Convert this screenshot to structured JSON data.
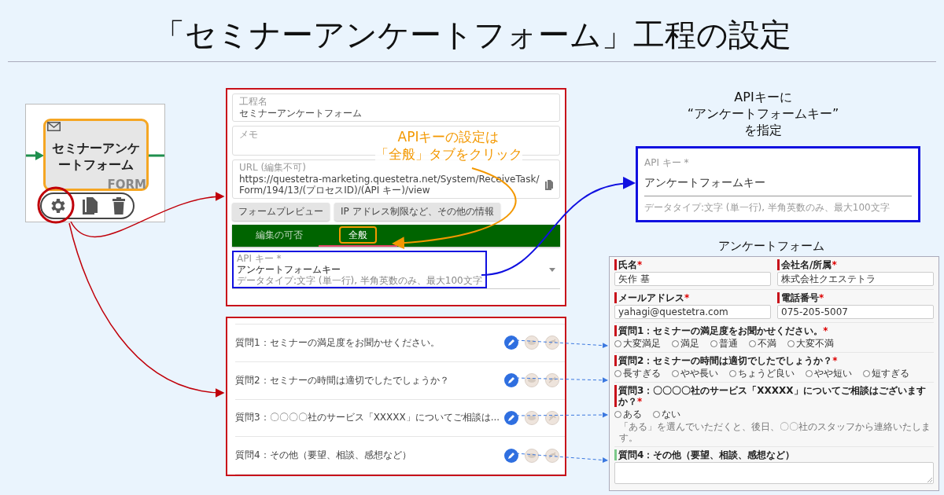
{
  "title": "「セミナーアンケートフォーム」工程の設定",
  "node": {
    "name": "セミナーアンケートフォーム",
    "tag": "FORM"
  },
  "settings": {
    "name_field": {
      "label": "工程名",
      "value": "セミナーアンケートフォーム"
    },
    "memo_field": {
      "label": "メモ"
    },
    "url_field": {
      "label": "URL (編集不可)",
      "value": "https://questetra-marketing.questetra.net/System/ReceiveTask/Form/194/13/(プロセスID)/(API キー)/view"
    },
    "buttons": [
      "フォームプレビュー",
      "IP アドレス制限など、その他の情報"
    ],
    "tabs": [
      {
        "label": "編集の可否",
        "selected": false
      },
      {
        "label": "全般",
        "selected": true
      }
    ],
    "api_field": {
      "label": "API キー *",
      "value": "アンケートフォームキー",
      "hint": "データタイプ:文字 (単一行), 半角英数のみ、最大100文字"
    }
  },
  "tab_callout": [
    "APIキーの設定は",
    "「全般」タブをクリック"
  ],
  "api_callout": [
    "APIキーに",
    "“アンケートフォームキー”",
    "を指定"
  ],
  "api_zoom": {
    "label": "API キー *",
    "value": "アンケートフォームキー",
    "hint": "データタイプ:文字 (単一行), 半角英数のみ、最大100文字"
  },
  "questions": [
    {
      "text": "質問1：セミナーの満足度をお聞かせください。"
    },
    {
      "text": "質問2：セミナーの時間は適切でしたでしょうか？"
    },
    {
      "text": "質問3：〇〇〇〇社のサービス「XXXXX」についてご相談は..."
    },
    {
      "text": "質問4：その他（要望、相談、感想など）"
    }
  ],
  "form_title": "アンケートフォーム",
  "form": {
    "field_rows": [
      [
        {
          "label": "氏名",
          "mark": "*",
          "required": true,
          "value": "矢作 基"
        },
        {
          "label": "会社名/所属",
          "mark": "*",
          "required": true,
          "value": "株式会社クエステトラ"
        }
      ],
      [
        {
          "label": "メールアドレス",
          "mark": "*",
          "required": true,
          "value": "yahagi@questetra.com"
        },
        {
          "label": "電話番号",
          "mark": "*",
          "required": true,
          "value": "075-205-5007"
        }
      ]
    ],
    "questions": [
      {
        "kind": "radio",
        "label": "質問1：セミナーの満足度をお聞かせください。",
        "mark": "*",
        "required": true,
        "options": [
          {
            "label": "大変満足",
            "selected": false
          },
          {
            "label": "満足",
            "selected": false
          },
          {
            "label": "普通",
            "selected": false
          },
          {
            "label": "不満",
            "selected": false
          },
          {
            "label": "大変不満",
            "selected": false
          }
        ]
      },
      {
        "kind": "radio",
        "label": "質問2：セミナーの時間は適切でしたでしょうか？",
        "mark": "*",
        "required": true,
        "options": [
          {
            "label": "長すぎる",
            "selected": false
          },
          {
            "label": "やや長い",
            "selected": false
          },
          {
            "label": "ちょうど良い",
            "selected": false
          },
          {
            "label": "やや短い",
            "selected": false
          },
          {
            "label": "短すぎる",
            "selected": false
          }
        ]
      },
      {
        "kind": "radio",
        "label": "質問3：〇〇〇〇社のサービス「XXXXX」についてご相談はございますか？",
        "mark": "*",
        "required": true,
        "options": [
          {
            "label": "ある",
            "selected": false
          },
          {
            "label": "ない",
            "selected": false
          }
        ],
        "note": "「ある」を選んでいただくと、後日、〇〇社のスタッフから連絡いたします。"
      },
      {
        "kind": "textarea",
        "label": "質問4：その他（要望、相談、感想など）",
        "required": false
      }
    ]
  }
}
